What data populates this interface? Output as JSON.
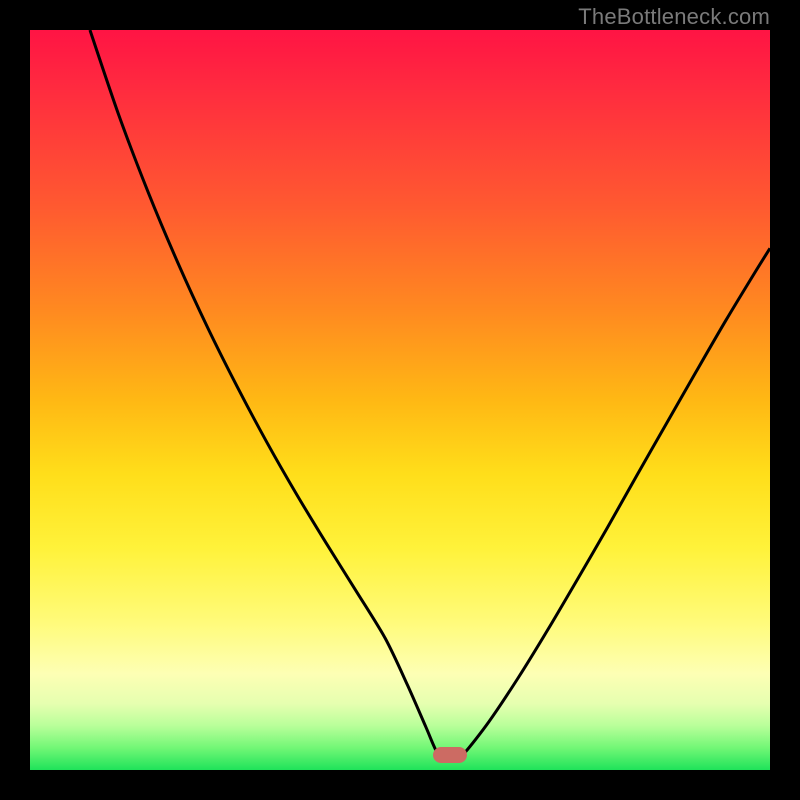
{
  "watermark": "TheBottleneck.com",
  "colors": {
    "curve": "#000000",
    "marker": "#cc6b63",
    "frame": "#000000"
  },
  "chart_data": {
    "type": "line",
    "title": "",
    "xlabel": "",
    "ylabel": "",
    "xlim": [
      0,
      100
    ],
    "ylim": [
      0,
      100
    ],
    "grid": false,
    "legend": false,
    "annotations": [
      {
        "kind": "watermark",
        "text": "TheBottleneck.com",
        "position": "top-right"
      },
      {
        "kind": "min-marker",
        "x": 56.8,
        "y": 2.0
      }
    ],
    "series": [
      {
        "name": "left-branch",
        "x": [
          8.1,
          12,
          16,
          20,
          24,
          28,
          32,
          36,
          40,
          44,
          48,
          51,
          53.5,
          55
        ],
        "y": [
          100,
          88.5,
          78.0,
          68.5,
          59.8,
          51.8,
          44.3,
          37.3,
          30.7,
          24.3,
          17.8,
          11.5,
          5.8,
          2.4
        ]
      },
      {
        "name": "valley",
        "x": [
          55,
          56,
          57,
          58,
          58.8
        ],
        "y": [
          2.4,
          2.0,
          2.0,
          2.1,
          2.4
        ]
      },
      {
        "name": "right-branch",
        "x": [
          58.8,
          62,
          66,
          70,
          74,
          78,
          82,
          86,
          90,
          94,
          98,
          100
        ],
        "y": [
          2.4,
          6.5,
          12.5,
          19.0,
          25.8,
          32.7,
          39.8,
          46.8,
          53.8,
          60.7,
          67.3,
          70.5
        ]
      }
    ]
  }
}
